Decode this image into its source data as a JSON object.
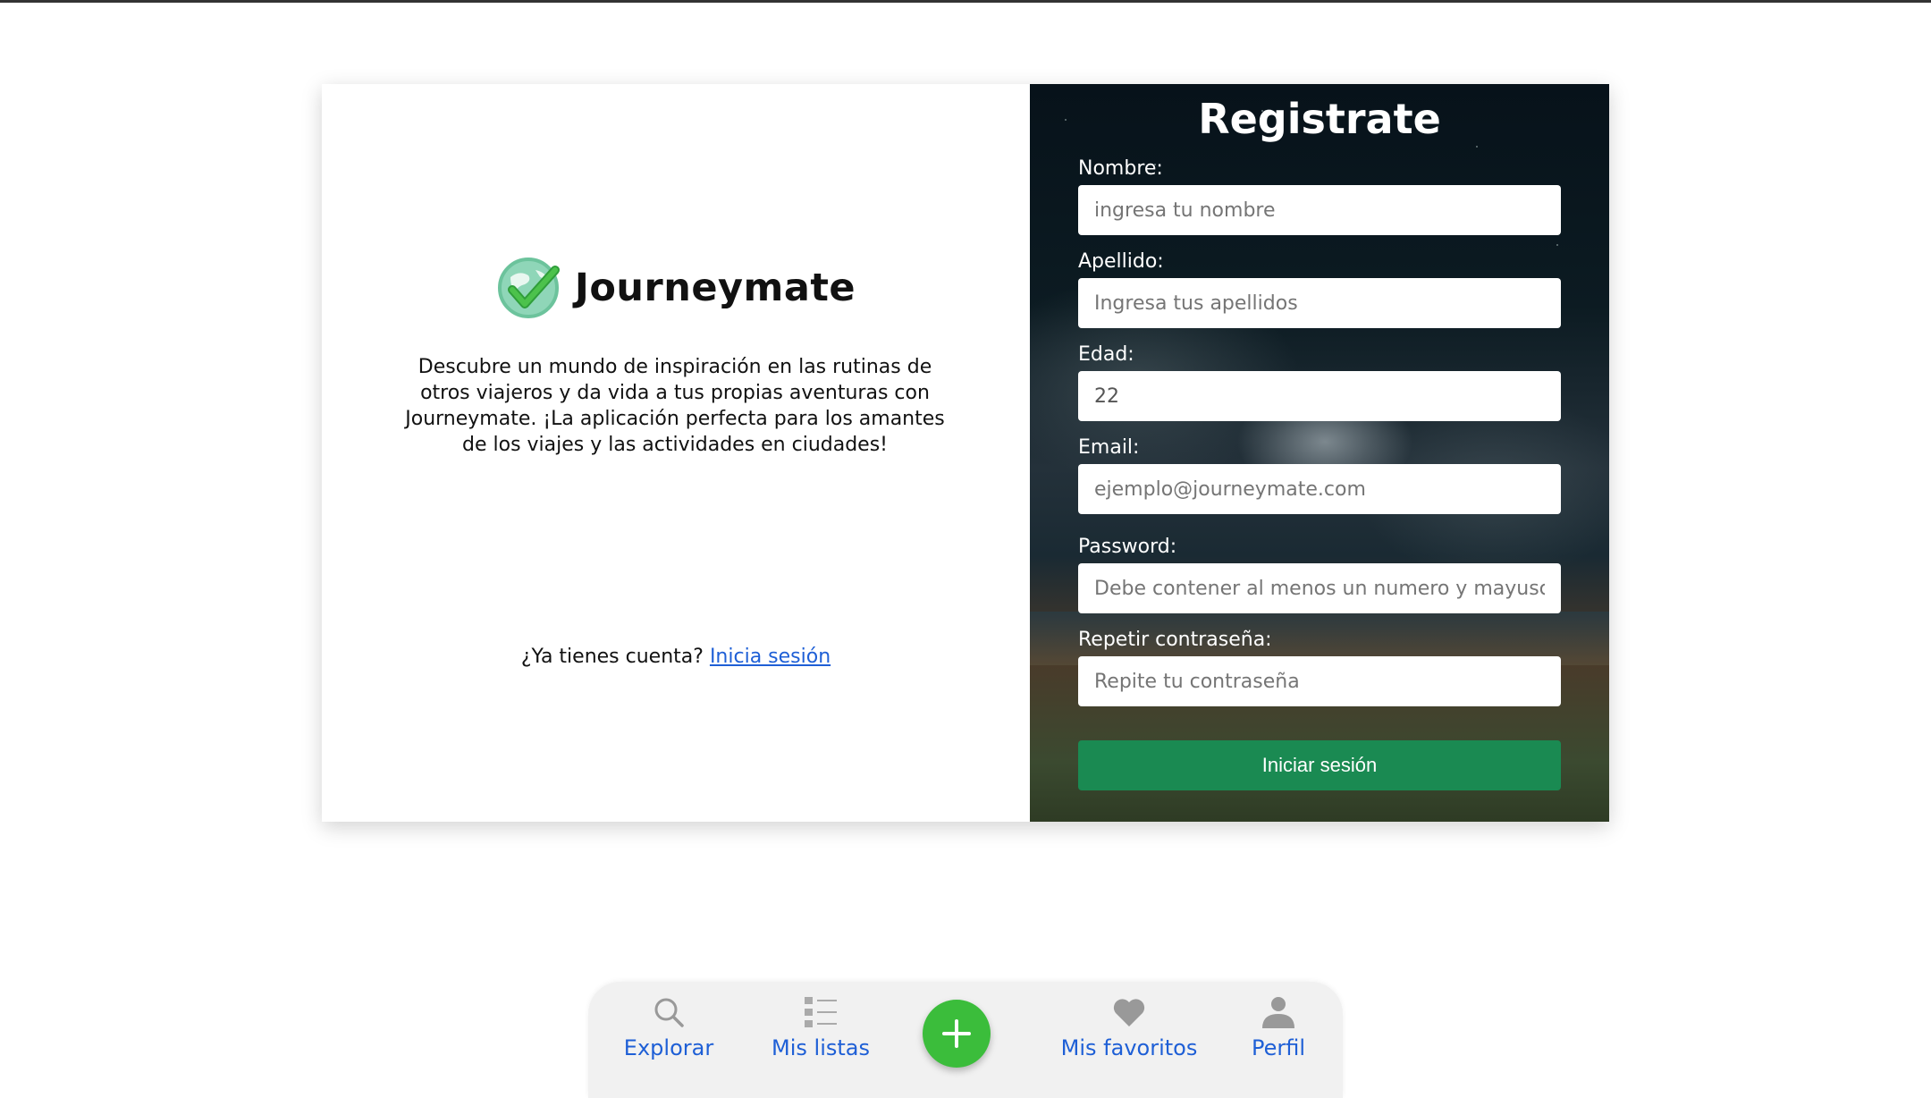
{
  "brand": {
    "name": "Journeymate",
    "tagline": "Descubre un mundo de inspiración en las rutinas de otros viajeros y da vida a tus propias aventuras con Journeymate. ¡La aplicación perfecta para los amantes de los viajes y las actividades en ciudades!",
    "accent": "#3bbd3b"
  },
  "login": {
    "prompt": "¿Ya tienes cuenta?",
    "link_label": "Inicia sesión"
  },
  "form": {
    "title": "Registrate",
    "fields": {
      "nombre": {
        "label": "Nombre:",
        "placeholder": "ingresa tu nombre"
      },
      "apellido": {
        "label": "Apellido:",
        "placeholder": "Ingresa tus apellidos"
      },
      "edad": {
        "label": "Edad:",
        "value": "22"
      },
      "email": {
        "label": "Email:",
        "placeholder": "ejemplo@journeymate.com"
      },
      "password": {
        "label": "Password:",
        "placeholder": "Debe contener al menos un numero y mayuscul"
      },
      "repetir": {
        "label": "Repetir contraseña:",
        "placeholder": "Repite tu contraseña"
      }
    },
    "submit_label": "Iniciar sesión",
    "submit_color": "#1a8a52"
  },
  "nav": {
    "items": [
      {
        "label": "Explorar",
        "icon": "search-icon"
      },
      {
        "label": "Mis listas",
        "icon": "list-icon"
      },
      {
        "label": "",
        "icon": "plus-icon"
      },
      {
        "label": "Mis favoritos",
        "icon": "heart-icon"
      },
      {
        "label": "Perfil",
        "icon": "user-icon"
      }
    ],
    "link_color": "#1e5fd6"
  }
}
